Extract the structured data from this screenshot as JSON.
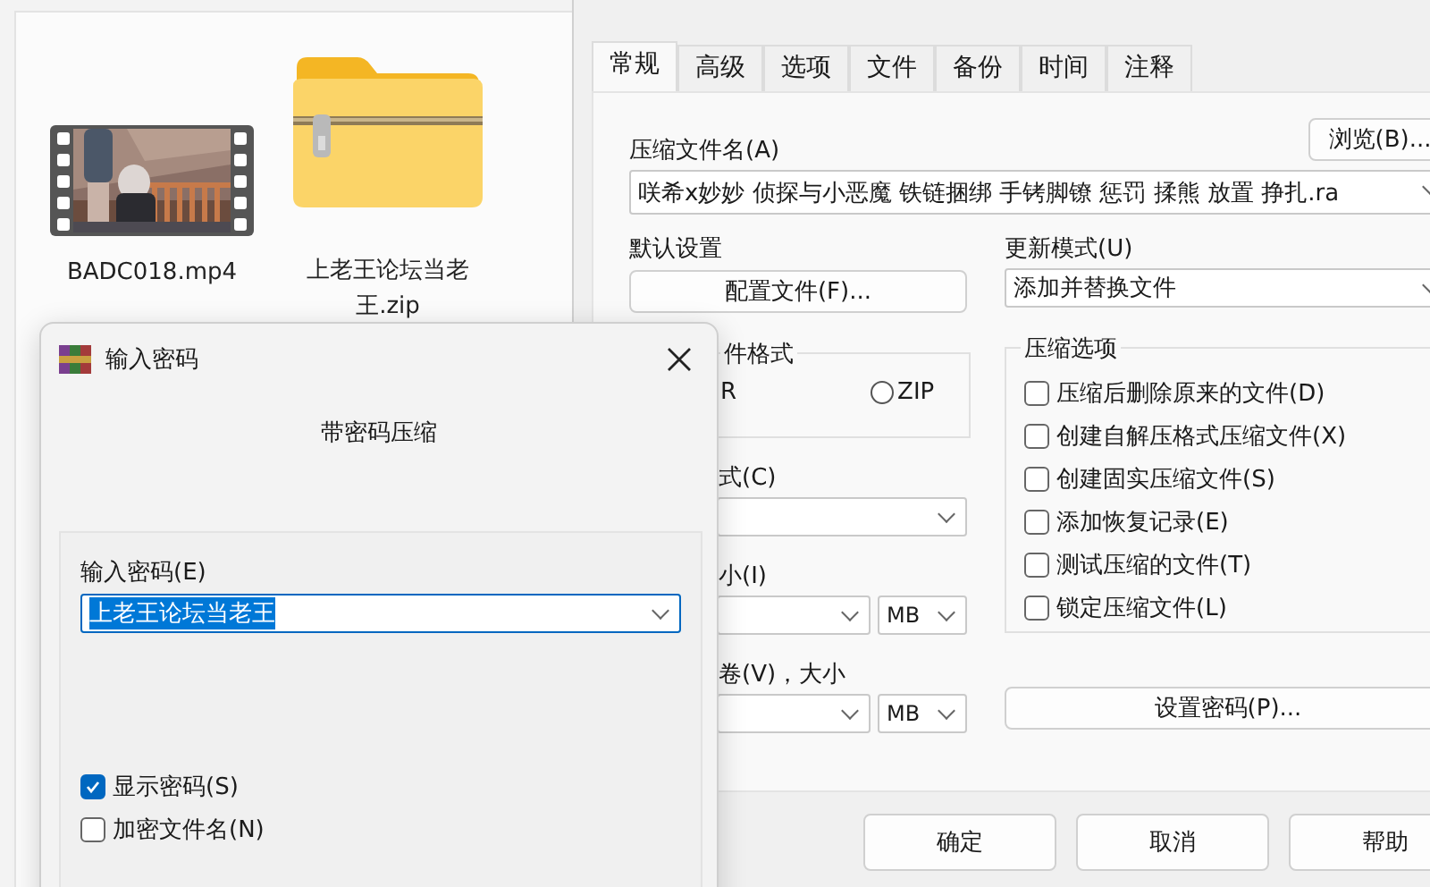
{
  "explorer": {
    "files": [
      {
        "name": "BADC018.mp4",
        "kind": "video"
      },
      {
        "name": "上老王论坛当老王.zip",
        "kind": "zip"
      }
    ]
  },
  "archive_dialog": {
    "tabs": [
      {
        "label": "常规",
        "selected": true
      },
      {
        "label": "高级",
        "selected": false
      },
      {
        "label": "选项",
        "selected": false
      },
      {
        "label": "文件",
        "selected": false
      },
      {
        "label": "备份",
        "selected": false
      },
      {
        "label": "时间",
        "selected": false
      },
      {
        "label": "注释",
        "selected": false
      }
    ],
    "archive_name_label": "压缩文件名(A)",
    "browse_button": "浏览(B)...",
    "archive_name": "咲希x妙妙 侦探与小恶魔 铁链捆绑 手铐脚镣 惩罚 揉熊 放置 挣扎.ra",
    "profile_label": "默认设置",
    "profile_button": "配置文件(F)...",
    "update_mode_label": "更新模式(U)",
    "update_mode": "添加并替换文件",
    "format_group": "件格式",
    "rar_label": "R",
    "zip_option": {
      "label": "ZIP",
      "selected": false
    },
    "compression_method_label": "式(C)",
    "dictionary_label": "小(I)",
    "dictionary_unit": "MB",
    "volume_label": "卷(V)，大小",
    "volume_unit": "MB",
    "options_group": "压缩选项",
    "options": [
      {
        "label": "压缩后删除原来的文件(D)",
        "checked": false
      },
      {
        "label": "创建自解压格式压缩文件(X)",
        "checked": false
      },
      {
        "label": "创建固实压缩文件(S)",
        "checked": false
      },
      {
        "label": "添加恢复记录(E)",
        "checked": false
      },
      {
        "label": "测试压缩的文件(T)",
        "checked": false
      },
      {
        "label": "锁定压缩文件(L)",
        "checked": false
      }
    ],
    "set_password_button": "设置密码(P)...",
    "buttons": [
      "确定",
      "取消",
      "帮助"
    ]
  },
  "password_dialog": {
    "title": "输入密码",
    "heading": "带密码压缩",
    "password_label": "输入密码(E)",
    "password": "上老王论坛当老王",
    "checkboxes": [
      {
        "label": "显示密码(S)",
        "checked": true
      },
      {
        "label": "加密文件名(N)",
        "checked": false
      }
    ]
  }
}
